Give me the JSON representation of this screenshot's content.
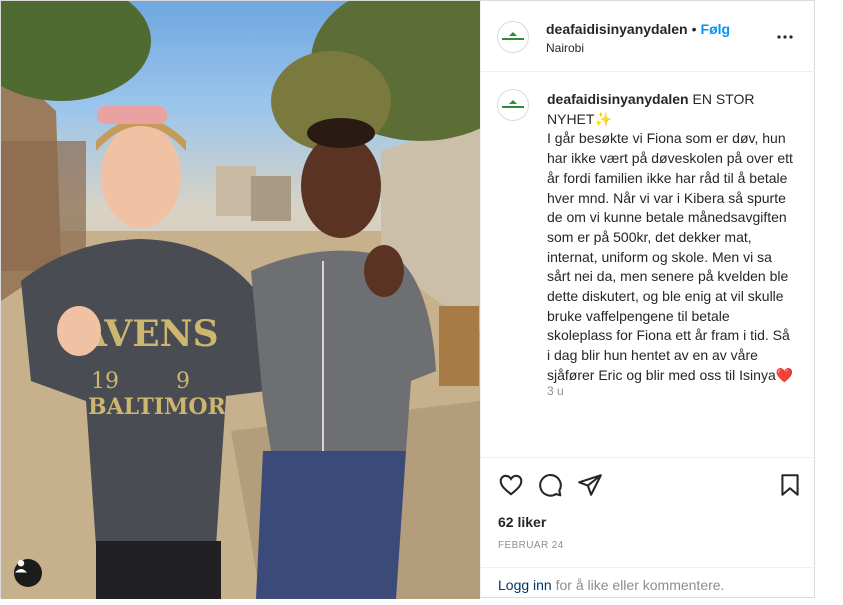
{
  "post": {
    "username": "deafaidisinyanydalen",
    "follow_label": "Følg",
    "separator": "•",
    "location": "Nairobi",
    "caption_title": "EN STOR NYHET✨",
    "caption_body": "I går besøkte vi Fiona som er døv, hun har ikke vært på døveskolen på over ett år fordi familien ikke har råd til å betale hver mnd. Når vi var i Kibera så spurte de om vi kunne betale månedsavgiften som er på 500kr, det dekker mat, internat, uniform og skole. Men vi sa sårt nei da, men senere på kvelden ble dette diskutert, og ble enig at vil skulle bruke vaffelpengene til betale skoleplass for Fiona ett år fram i tid. Så i dag blir hun hentet av en av våre sjåfører Eric og blir med oss til Isinya❤️",
    "time_ago": "3 u",
    "likes": "62 liker",
    "date": "FEBRUAR 24",
    "login_link": "Logg inn",
    "login_text": " for å like eller kommentere."
  },
  "icons": {
    "more": "more-options-icon",
    "like": "heart-icon",
    "comment": "comment-icon",
    "share": "send-icon",
    "save": "bookmark-icon",
    "tag": "user-tag-icon"
  },
  "colors": {
    "follow": "#0095f6",
    "login": "#00376b",
    "brand_green": "#2e8b3a"
  }
}
